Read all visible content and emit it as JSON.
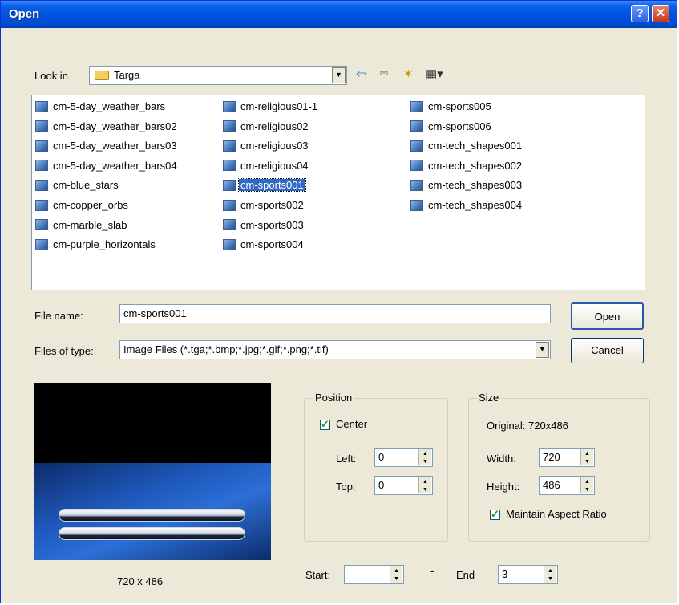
{
  "window": {
    "title": "Open",
    "help_label": "?",
    "close_label": "✕"
  },
  "lookin": {
    "label": "Look in",
    "value": "Targa",
    "icons": [
      "back-arrow-icon",
      "up-folder-icon",
      "new-folder-icon",
      "view-menu-icon"
    ]
  },
  "files": {
    "col1": [
      "cm-5-day_weather_bars",
      "cm-5-day_weather_bars02",
      "cm-5-day_weather_bars03",
      "cm-5-day_weather_bars04",
      "cm-blue_stars",
      "cm-copper_orbs",
      "cm-marble_slab",
      "cm-purple_horizontals"
    ],
    "col2": [
      "cm-religious01-1",
      "cm-religious02",
      "cm-religious03",
      "cm-religious04",
      "cm-sports001",
      "cm-sports002",
      "cm-sports003",
      "cm-sports004"
    ],
    "col3": [
      "cm-sports005",
      "cm-sports006",
      "cm-tech_shapes001",
      "cm-tech_shapes002",
      "cm-tech_shapes003",
      "cm-tech_shapes004"
    ],
    "selected": "cm-sports001"
  },
  "filename": {
    "label": "File name:",
    "value": "cm-sports001"
  },
  "filetype": {
    "label": "Files of type:",
    "value": "Image Files (*.tga;*.bmp;*.jpg;*.gif;*.png;*.tif)"
  },
  "buttons": {
    "open": "Open",
    "cancel": "Cancel"
  },
  "preview": {
    "caption": "720 x 486"
  },
  "position": {
    "legend": "Position",
    "center_label": "Center",
    "center_checked": true,
    "left_label": "Left:",
    "left_value": "0",
    "top_label": "Top:",
    "top_value": "0"
  },
  "size": {
    "legend": "Size",
    "original": "Original: 720x486",
    "width_label": "Width:",
    "width_value": "720",
    "height_label": "Height:",
    "height_value": "486",
    "aspect_label": "Maintain Aspect Ratio",
    "aspect_checked": true
  },
  "range": {
    "start_label": "Start:",
    "start_value": "",
    "dash": "-",
    "end_label": "End",
    "end_value": "3"
  }
}
